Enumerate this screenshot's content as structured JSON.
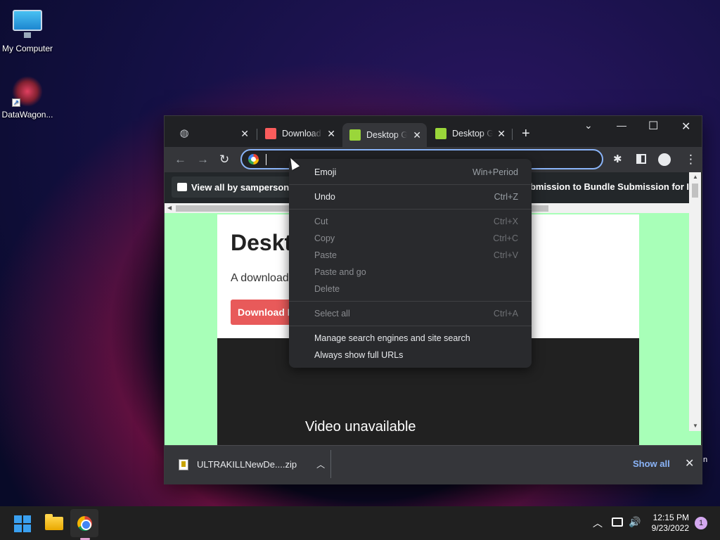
{
  "desktop": {
    "icons": [
      {
        "label": "My Computer",
        "icon": "monitor-icon"
      },
      {
        "label": "DataWagon...",
        "icon": "datawagon-icon"
      }
    ]
  },
  "browser": {
    "tabs": [
      {
        "title": "",
        "icon": "globe-icon",
        "active": false
      },
      {
        "title": "Download",
        "icon": "itch-icon",
        "active": false
      },
      {
        "title": "Desktop G",
        "icon": "green-leaf-icon",
        "active": true
      },
      {
        "title": "Desktop G",
        "icon": "green-leaf-icon",
        "active": false
      }
    ],
    "new_tab_symbol": "+",
    "window_controls": {
      "minimize": "—",
      "maximize": "☐",
      "close": "✕",
      "tab_search": "⌄"
    },
    "omnibox_value": "",
    "page": {
      "view_all_label": "View all by samperson",
      "bundle_text": "ubmission to Bundle Submission for Indi",
      "title": "Deskt",
      "description": "A download",
      "download_button": "Download N",
      "video_text": "Video unavailable"
    },
    "downloads": {
      "file": "ULTRAKILLNewDe....zip",
      "show_all": "Show all",
      "close": "✕"
    }
  },
  "context_menu": {
    "groups": [
      [
        {
          "label": "Emoji",
          "shortcut": "Win+Period",
          "enabled": true
        }
      ],
      [
        {
          "label": "Undo",
          "shortcut": "Ctrl+Z",
          "enabled": true
        }
      ],
      [
        {
          "label": "Cut",
          "shortcut": "Ctrl+X",
          "enabled": false
        },
        {
          "label": "Copy",
          "shortcut": "Ctrl+C",
          "enabled": false
        },
        {
          "label": "Paste",
          "shortcut": "Ctrl+V",
          "enabled": false
        },
        {
          "label": "Paste and go",
          "shortcut": "",
          "enabled": false
        },
        {
          "label": "Delete",
          "shortcut": "",
          "enabled": false
        }
      ],
      [
        {
          "label": "Select all",
          "shortcut": "Ctrl+A",
          "enabled": false
        }
      ],
      [
        {
          "label": "Manage search engines and site search",
          "shortcut": "",
          "enabled": true
        },
        {
          "label": "Always show full URLs",
          "shortcut": "",
          "enabled": true
        }
      ]
    ]
  },
  "taskbar": {
    "time": "12:15 PM",
    "date": "9/23/2022",
    "notification_count": "1",
    "colors": {
      "accent": "#3aa0f0"
    }
  },
  "stray_text": "n"
}
